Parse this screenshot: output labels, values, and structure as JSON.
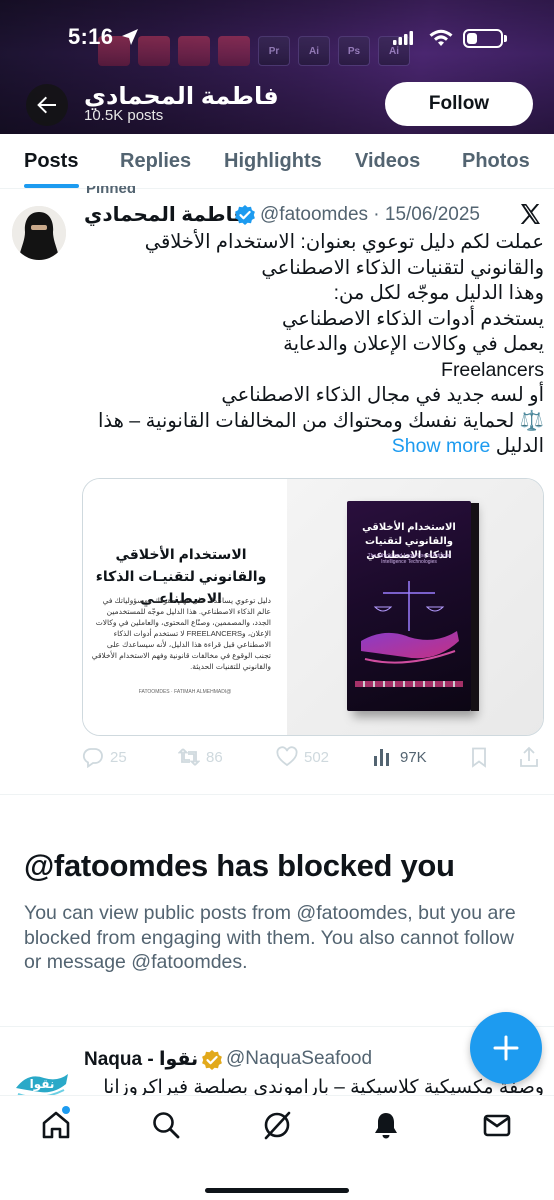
{
  "status_bar": {
    "time": "5:16"
  },
  "header": {
    "profile_name": "فاطمة المحمادي",
    "post_count": "10.5K posts",
    "follow_label": "Follow",
    "badge_labels": [
      "Pr",
      "Ai",
      "Ps",
      "Ai"
    ]
  },
  "tabs": [
    {
      "label": "Posts",
      "active": true
    },
    {
      "label": "Replies",
      "active": false
    },
    {
      "label": "Highlights",
      "active": false
    },
    {
      "label": "Videos",
      "active": false
    },
    {
      "label": "Photos",
      "active": false
    }
  ],
  "pinned_label": "Pinned",
  "tweet1": {
    "name": "فاطمة المحمادي",
    "handle_date": "@fatoomdes · 15/06/2025",
    "lines": [
      "عملت لكم دليل توعوي بعنوان: الاستخدام الأخلاقي",
      "والقانوني لتقنيات الذكاء الاصطناعي",
      "وهذا الدليل موجّه لكل من:",
      "يستخدم أدوات الذكاء الاصطناعي",
      "يعمل في وكالات الإعلان والدعاية",
      "Freelancers",
      "أو لسه جديد في مجال الذكاء الاصطناعي",
      "⚖️ لحماية نفسك ومحتواك من المخالفات القانونية – هذا"
    ],
    "last_line": "الدليل",
    "show_more": "Show more",
    "card": {
      "title": "الاستخدام الأخلاقي والقانوني لتقنيـات الذكاء الاصطناعـي",
      "text": "دليل توعوي يساعدك على فهم حقوقك ومسؤولياتك في عالم الذكاء الاصطناعي. هذا الدليل موجّه للمستخدمين الجدد، والمصممين، وصنّاع المحتوى، والعاملين في وكالات الإعلان، وFREELANCERS لا تستخدم أدوات الذكاء الاصطناعي قبل قراءة هذا الدليل، لأنه سيساعدك على تجنب الوقوع في مخالفات قانونية وفهم الاستخدام الأخلاقي والقانوني للتقنيات الحديثة.",
      "handle": "@FATOOMDES · FATIMAH ALMEHMADI",
      "book_title": "الاستخدام الأخلاقي والقانوني لتقنيات الذكاء الاصطناعي",
      "book_subtitle": "The Ethical and Legal Use of Artificial Intelligence Technologies"
    },
    "actions": {
      "replies": "25",
      "reposts": "86",
      "likes": "502",
      "views": "97K"
    }
  },
  "blocked": {
    "title": "@fatoomdes has blocked you",
    "text": "You can view public posts from @fatoomdes, but you are blocked from engaging with them. You also cannot follow or message @fatoomdes."
  },
  "tweet2": {
    "name": "Naqua - نقوا",
    "handle": "@NaquaSeafood",
    "text": "وصفة مكسيكية كلاسيكية – باراموندي بصلصة فيراكروزانا",
    "avatar_text": "نقوا"
  },
  "bottom_nav": [
    "home-icon",
    "search-icon",
    "grok-icon",
    "notifications-icon",
    "messages-icon"
  ],
  "colors": {
    "accent": "#1d9bf0",
    "text": "#0f1419",
    "muted": "#536471",
    "gold": "#e2a91b"
  }
}
